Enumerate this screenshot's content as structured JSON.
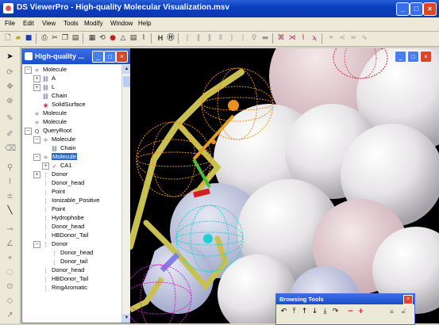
{
  "window": {
    "title": "DS ViewerPro - High-quality Molecular Visualization.msv"
  },
  "menu": [
    "File",
    "Edit",
    "View",
    "Tools",
    "Modify",
    "Window",
    "Help"
  ],
  "toolbar": {
    "h_label": "H"
  },
  "panel": {
    "title": "High-quality ..."
  },
  "tree": [
    {
      "label": "Molecule",
      "icon": "molecule-icon"
    },
    {
      "label": "A",
      "icon": "chain-icon"
    },
    {
      "label": "L",
      "icon": "chain-icon"
    },
    {
      "label": "Chain",
      "icon": "chain-icon"
    },
    {
      "label": "SolidSurface",
      "icon": "surface-icon"
    },
    {
      "label": "Molecule",
      "icon": "molecule-icon"
    },
    {
      "label": "Molecule",
      "icon": "molecule-icon"
    },
    {
      "label": "QueryRoot",
      "icon": "query-icon"
    },
    {
      "label": "Molecule",
      "icon": "molecule-icon"
    },
    {
      "label": "Chain",
      "icon": "chain-icon"
    },
    {
      "label": "Molecule",
      "icon": "molecule-icon"
    },
    {
      "label": "CA1",
      "icon": "atom-icon"
    },
    {
      "label": "Donor",
      "icon": "feature-icon"
    },
    {
      "label": "Donor_head",
      "icon": "feature-icon"
    },
    {
      "label": "Point",
      "icon": "feature-icon"
    },
    {
      "label": "Ionizable_Positive",
      "icon": "feature-icon"
    },
    {
      "label": "Point",
      "icon": "feature-icon"
    },
    {
      "label": "Hydrophobe",
      "icon": "feature-icon"
    },
    {
      "label": "Donor_head",
      "icon": "feature-icon"
    },
    {
      "label": "HBDonor_Tail",
      "icon": "feature-icon"
    },
    {
      "label": "Donor",
      "icon": "feature-icon"
    },
    {
      "label": "Donor_head",
      "icon": "feature-icon"
    },
    {
      "label": "Donor_tail",
      "icon": "feature-icon"
    },
    {
      "label": "Donor_head",
      "icon": "feature-icon"
    },
    {
      "label": "HBDonor_Tail",
      "icon": "feature-icon"
    },
    {
      "label": "RingAromatic",
      "icon": "feature-icon"
    }
  ],
  "browsing_tools": {
    "title": "Browsing Tools"
  }
}
